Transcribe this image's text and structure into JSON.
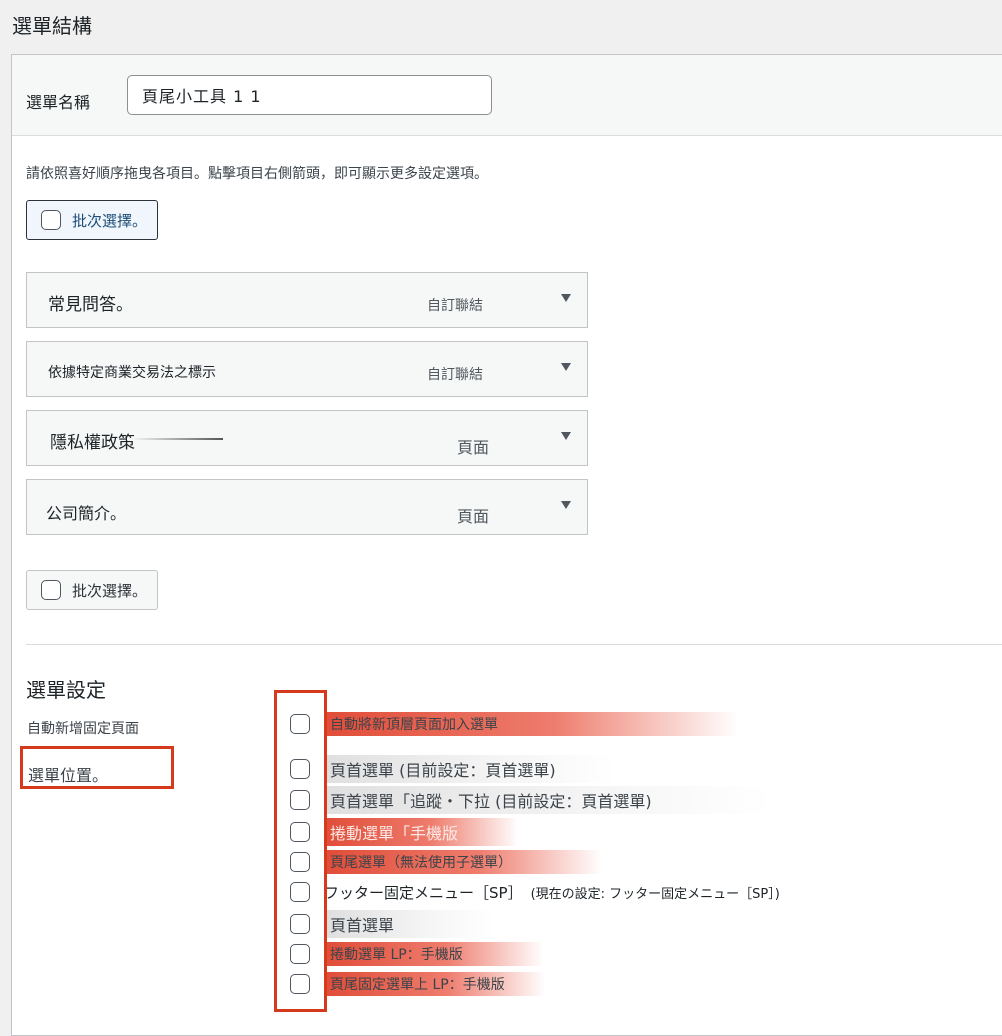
{
  "page_title": "選單結構",
  "menu_name": {
    "label": "選單名稱",
    "value": "頁尾小工具 1 1"
  },
  "instructions": "請依照喜好順序拖曳各項目。點擊項目右側箭頭，即可顯示更多設定選項。",
  "bulk_select_label": "批次選擇。",
  "menu_items": [
    {
      "title": "常見問答。",
      "type": "自訂聯結"
    },
    {
      "title": "依據特定商業交易法之標示",
      "type": "自訂聯結"
    },
    {
      "title": "隱私權政策",
      "type": "頁面"
    },
    {
      "title": "公司簡介。",
      "type": "頁面"
    }
  ],
  "settings": {
    "title": "選單設定",
    "auto_add_label": "自動新增固定頁面",
    "auto_add_option": "自動將新頂層頁面加入選單",
    "locations_label": "選單位置。",
    "locations": [
      {
        "label": "頁首選單 (目前設定：頁首選單)"
      },
      {
        "label": "頁首選單「追蹤・下拉 (目前設定：頁首選單)"
      },
      {
        "label": "捲動選單「手機版"
      },
      {
        "label": "頁尾選單（無法使用子選單）"
      },
      {
        "label": "フッター固定メニュー［SP］",
        "current": "(現在の設定: フッター固定メニュー［SP］)"
      },
      {
        "label": "頁首選單"
      },
      {
        "label": "捲動選單 LP：手機版"
      },
      {
        "label": "頁尾固定選單上 LP：手機版"
      }
    ]
  },
  "colors": {
    "highlight_red": "#d63a1d",
    "background": "#f0f0f1",
    "panel": "#ffffff"
  }
}
